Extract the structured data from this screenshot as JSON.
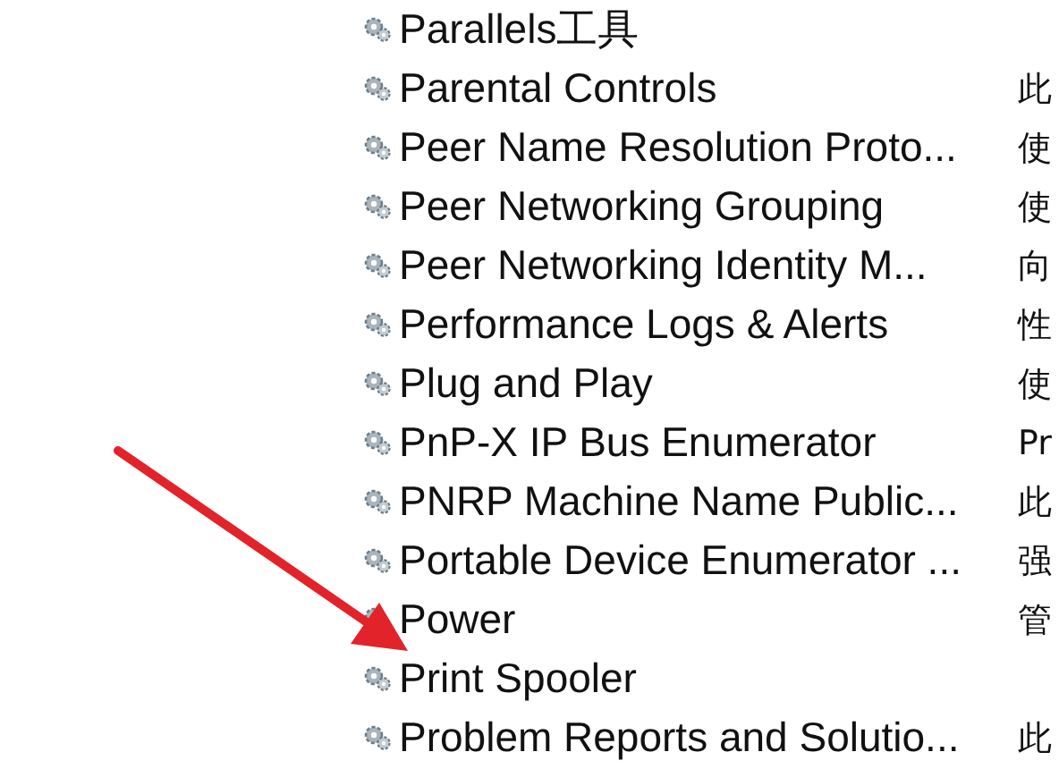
{
  "services": {
    "rows": [
      {
        "name": "Parallels工具"
      },
      {
        "name": "Parental Controls",
        "description": "此"
      },
      {
        "name": "Peer Name Resolution Proto...",
        "description": "使"
      },
      {
        "name": "Peer Networking Grouping",
        "description": "使"
      },
      {
        "name": "Peer Networking Identity M...",
        "description": "向"
      },
      {
        "name": "Performance Logs & Alerts",
        "description": "性"
      },
      {
        "name": "Plug and Play",
        "description": "使"
      },
      {
        "name": "PnP-X IP Bus Enumerator",
        "description": "Pr"
      },
      {
        "name": "PNRP Machine Name Public...",
        "description": "此"
      },
      {
        "name": "Portable Device Enumerator ...",
        "description": "强"
      },
      {
        "name": "Power",
        "description": "管"
      },
      {
        "name": "Print Spooler"
      },
      {
        "name": "Problem Reports and Solutio...",
        "description": "此"
      }
    ]
  }
}
